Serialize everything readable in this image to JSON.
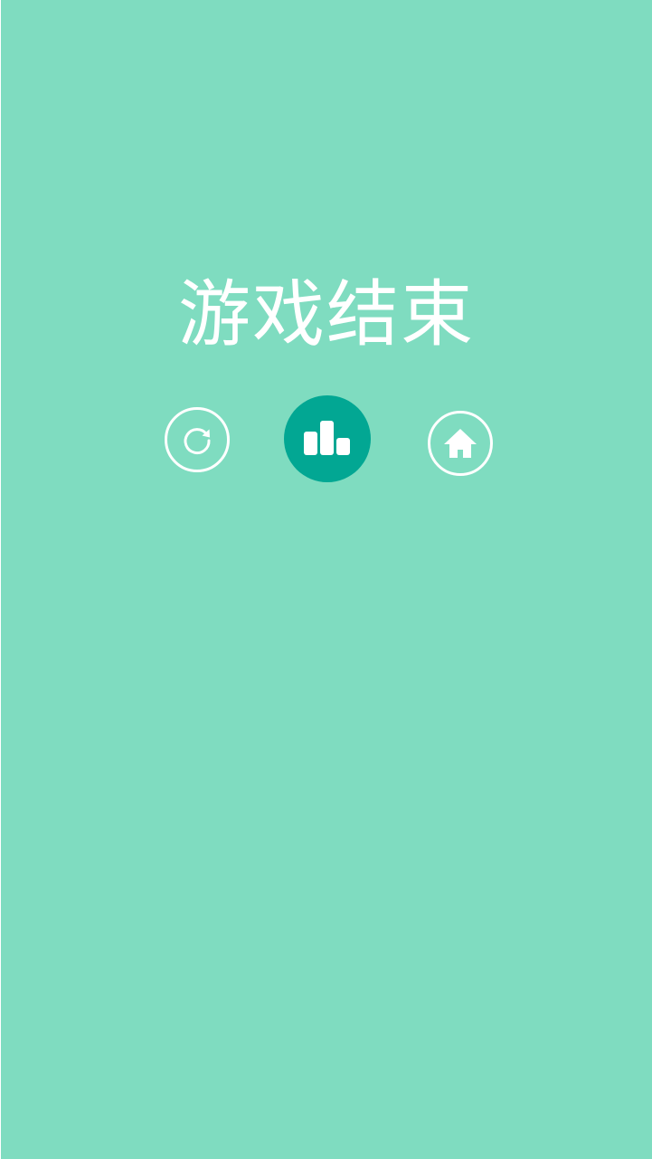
{
  "game_over": {
    "title": "游戏结束"
  },
  "actions": {
    "restart": {
      "icon": "refresh-icon"
    },
    "leaderboard": {
      "icon": "bar-chart-icon"
    },
    "home": {
      "icon": "home-icon"
    }
  },
  "colors": {
    "background": "#7fdcc0",
    "accent": "#02a793",
    "foreground": "#ffffff"
  }
}
